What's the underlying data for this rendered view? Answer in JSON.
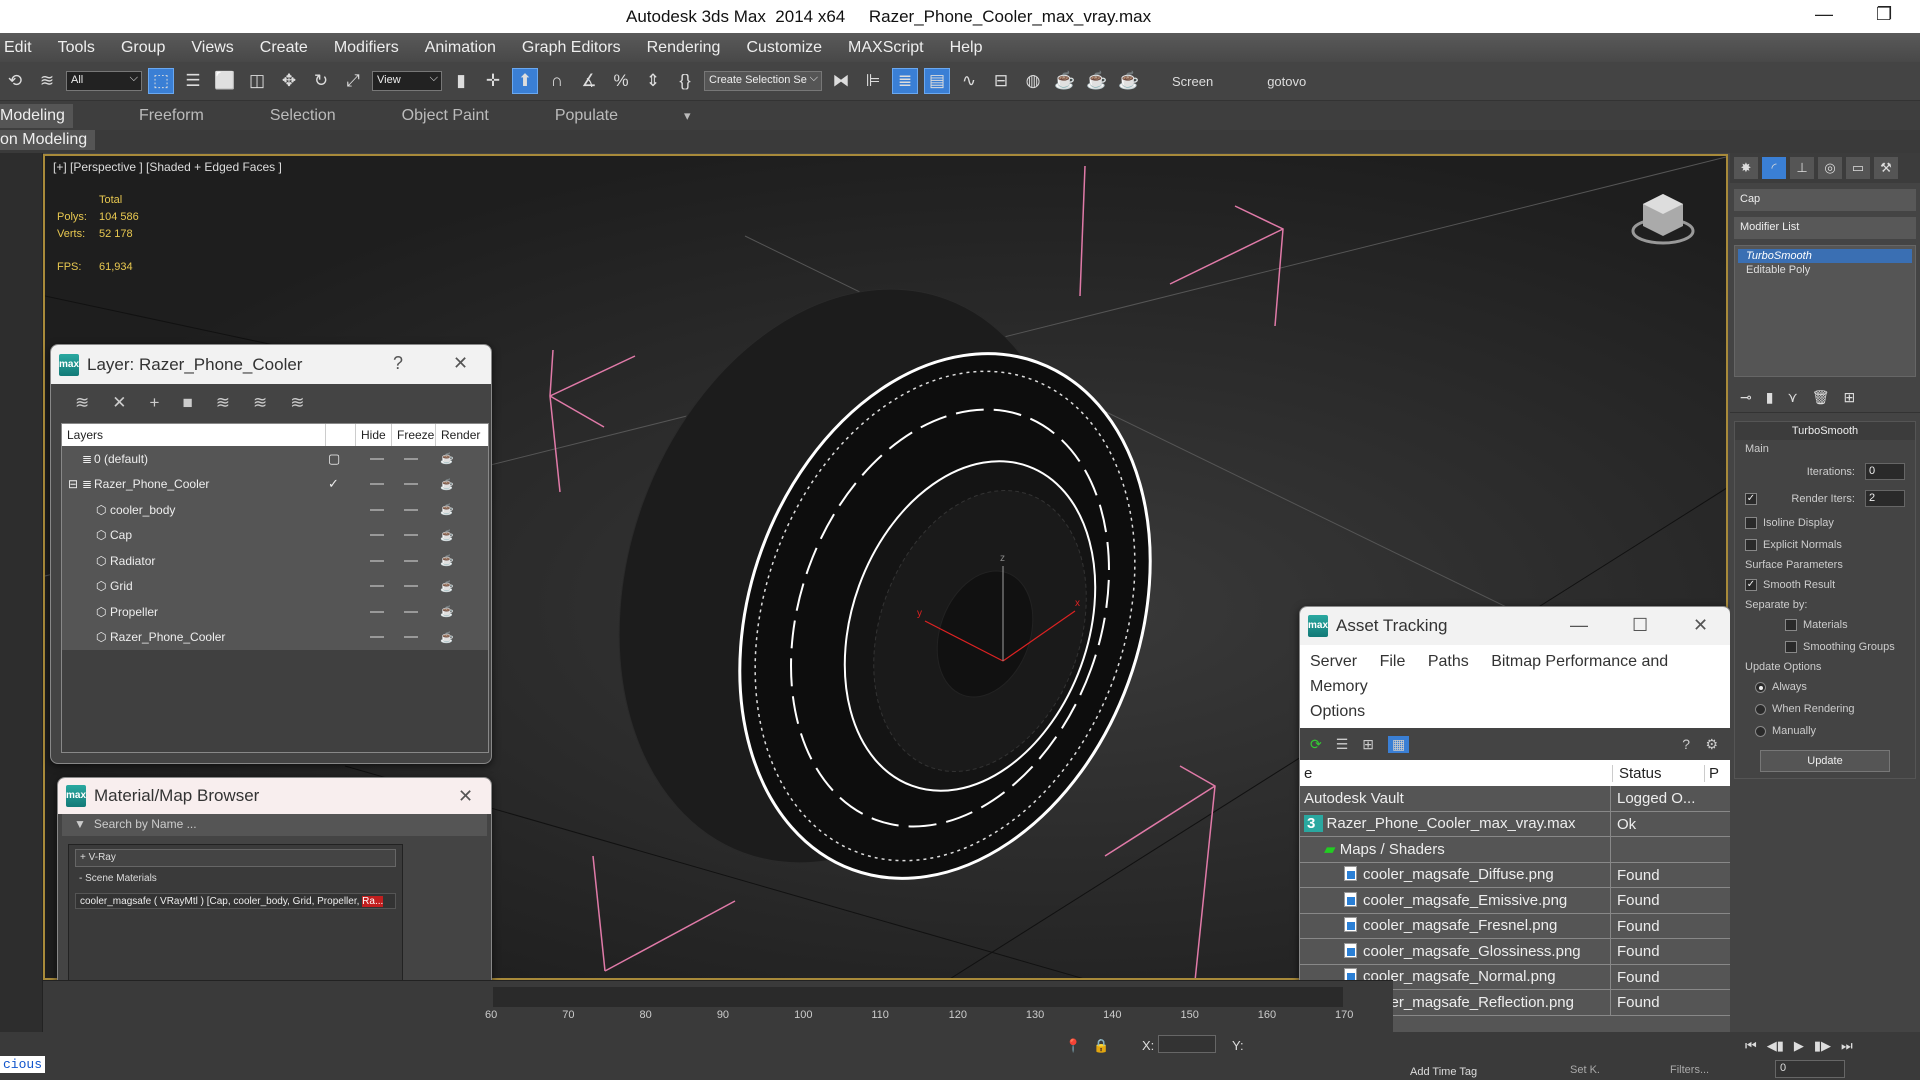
{
  "window": {
    "title": "Autodesk 3ds Max  2014 x64     Razer_Phone_Cooler_max_vray.max",
    "minimize_icon": "minimize-icon",
    "maximize_icon": "restore-icon"
  },
  "menu": [
    "Edit",
    "Tools",
    "Group",
    "Views",
    "Create",
    "Modifiers",
    "Animation",
    "Graph Editors",
    "Rendering",
    "Customize",
    "MAXScript",
    "Help"
  ],
  "toolbar": {
    "filter_select": "All",
    "ref_coord_select": "View",
    "named_selection_select": "Create Selection Se",
    "render_text_1": "Screen",
    "render_text_2": "gotovo"
  },
  "ribbon": {
    "tabs": [
      "Modeling",
      "Freeform",
      "Selection",
      "Object Paint",
      "Populate"
    ],
    "active_tab": "Modeling",
    "sub_label": "on Modeling"
  },
  "viewport": {
    "label": "[+] [Perspective ] [Shaded + Edged Faces ]",
    "stats": {
      "header": "Total",
      "polys_label": "Polys:",
      "polys_value": "104 586",
      "verts_label": "Verts:",
      "verts_value": "52 178",
      "fps_label": "FPS:",
      "fps_value": "61,934"
    },
    "axis_labels": {
      "x": "x",
      "y": "y",
      "z": "z"
    }
  },
  "layer_dialog": {
    "title": "Layer: Razer_Phone_Cooler",
    "help": "?",
    "columns": [
      "Layers",
      "",
      "Hide",
      "Freeze",
      "Render"
    ],
    "rows": [
      {
        "name": "0 (default)",
        "indent": 1,
        "type": "layer",
        "current": "box"
      },
      {
        "name": "Razer_Phone_Cooler",
        "indent": 1,
        "type": "layer",
        "current": "check",
        "expanded": true
      },
      {
        "name": "cooler_body",
        "indent": 2,
        "type": "object"
      },
      {
        "name": "Cap",
        "indent": 2,
        "type": "object"
      },
      {
        "name": "Radiator",
        "indent": 2,
        "type": "object"
      },
      {
        "name": "Grid",
        "indent": 2,
        "type": "object"
      },
      {
        "name": "Propeller",
        "indent": 2,
        "type": "object"
      },
      {
        "name": "Razer_Phone_Cooler",
        "indent": 2,
        "type": "object"
      }
    ]
  },
  "material_browser": {
    "title": "Material/Map Browser",
    "search_placeholder": "Search by Name ...",
    "groups": [
      {
        "label": "+ V-Ray"
      },
      {
        "label": "- Scene Materials"
      }
    ],
    "item_text": "cooler_magsafe ( VRayMtl ) [Cap, cooler_body, Grid, Propeller, ",
    "item_text_highlight": "Ra..."
  },
  "asset_tracking": {
    "title": "Asset Tracking",
    "menu": [
      "Server",
      "File",
      "Paths",
      "Bitmap Performance and Memory",
      "Options"
    ],
    "columns": [
      "e",
      "Status",
      "P"
    ],
    "rows": [
      {
        "name": "Autodesk Vault",
        "status": "Logged O...",
        "level": 0,
        "icon": "vault"
      },
      {
        "name": "Razer_Phone_Cooler_max_vray.max",
        "status": "Ok",
        "level": 0,
        "icon": "max-file"
      },
      {
        "name": "Maps / Shaders",
        "status": "",
        "level": 1,
        "icon": "maps"
      },
      {
        "name": "cooler_magsafe_Diffuse.png",
        "status": "Found",
        "level": 2,
        "icon": "image"
      },
      {
        "name": "cooler_magsafe_Emissive.png",
        "status": "Found",
        "level": 2,
        "icon": "image"
      },
      {
        "name": "cooler_magsafe_Fresnel.png",
        "status": "Found",
        "level": 2,
        "icon": "image"
      },
      {
        "name": "cooler_magsafe_Glossiness.png",
        "status": "Found",
        "level": 2,
        "icon": "image"
      },
      {
        "name": "cooler_magsafe_Normal.png",
        "status": "Found",
        "level": 2,
        "icon": "image"
      },
      {
        "name": "cooler_magsafe_Reflection.png",
        "status": "Found",
        "level": 2,
        "icon": "image"
      }
    ]
  },
  "command_panel": {
    "object_name": "Cap",
    "modifier_list": "Modifier List",
    "stack": [
      "TurboSmooth",
      "Editable Poly"
    ],
    "rollout_title": "TurboSmooth",
    "main_label": "Main",
    "iterations_label": "Iterations:",
    "iterations_value": "0",
    "render_iters_label": "Render Iters:",
    "render_iters_value": "2",
    "render_iters_checked": true,
    "isoline_label": "Isoline Display",
    "explicit_normals_label": "Explicit Normals",
    "surface_params_label": "Surface Parameters",
    "smooth_result_label": "Smooth Result",
    "smooth_result_checked": true,
    "separate_by_label": "Separate by:",
    "materials_label": "Materials",
    "smoothing_groups_label": "Smoothing Groups",
    "update_options_label": "Update Options",
    "update_always": "Always",
    "update_when_rendering": "When Rendering",
    "update_manually": "Manually",
    "update_button": "Update"
  },
  "timeline": {
    "ticks": [
      "60",
      "70",
      "80",
      "90",
      "100",
      "110",
      "120",
      "130",
      "140",
      "150",
      "160",
      "170"
    ]
  },
  "statusbar": {
    "x_label": "X:",
    "y_label": "Y:",
    "add_time_tag": "Add Time Tag",
    "set_key": "Set K.",
    "filters": "Filters...",
    "frame_value": "0",
    "maxscript_snippet": "cious"
  }
}
